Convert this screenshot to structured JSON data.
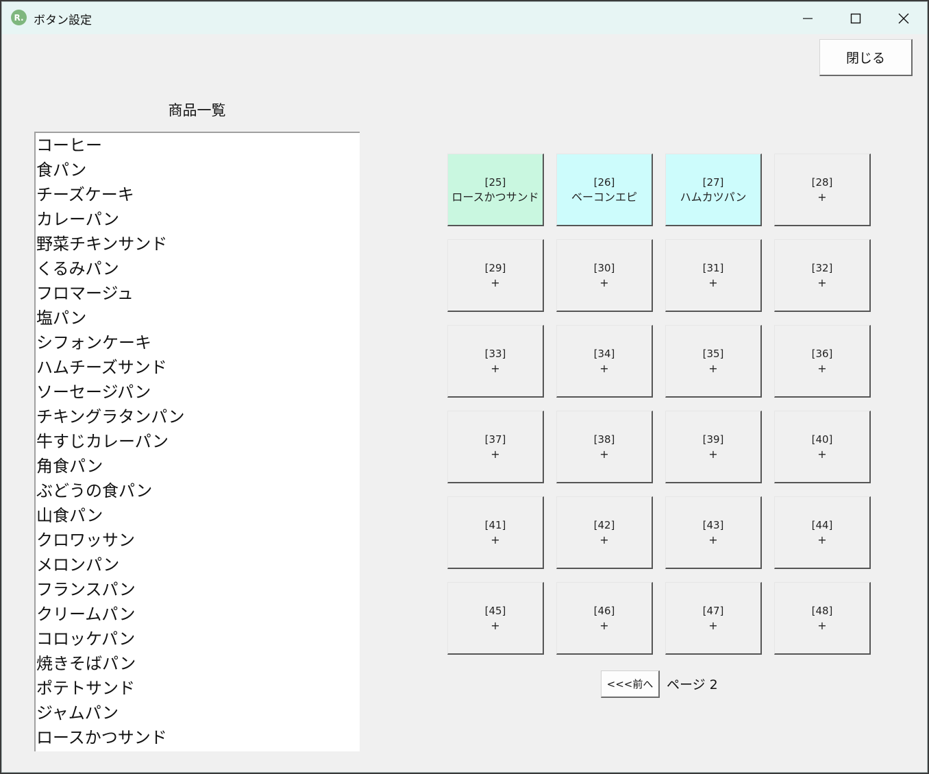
{
  "window": {
    "title": "ボタン設定",
    "app_icon_text": "R.",
    "controls": [
      "minimize",
      "maximize",
      "close"
    ]
  },
  "header": {
    "close_label": "閉じる"
  },
  "product_list": {
    "title": "商品一覧",
    "items": [
      "コーヒー",
      "食パン",
      "チーズケーキ",
      "カレーパン",
      "野菜チキンサンド",
      "くるみパン",
      "フロマージュ",
      "塩パン",
      "シフォンケーキ",
      "ハムチーズサンド",
      "ソーセージパン",
      "チキングラタンパン",
      "牛すじカレーパン",
      "角食パン",
      "ぶどうの食パン",
      "山食パン",
      "クロワッサン",
      "メロンパン",
      "フランスパン",
      "クリームパン",
      "コロッケパン",
      "焼きそばパン",
      "ポテトサンド",
      "ジャムパン",
      "ロースかつサンド"
    ]
  },
  "button_grid": {
    "slots": [
      {
        "id": "[25]",
        "label": "ロースかつサンド",
        "color": "#c9f7e0"
      },
      {
        "id": "[26]",
        "label": "ベーコンエピ",
        "color": "#cdfcfc"
      },
      {
        "id": "[27]",
        "label": "ハムカツパン",
        "color": "#cdfcfc"
      },
      {
        "id": "[28]",
        "label": "+"
      },
      {
        "id": "[29]",
        "label": "+"
      },
      {
        "id": "[30]",
        "label": "+"
      },
      {
        "id": "[31]",
        "label": "+"
      },
      {
        "id": "[32]",
        "label": "+"
      },
      {
        "id": "[33]",
        "label": "+"
      },
      {
        "id": "[34]",
        "label": "+"
      },
      {
        "id": "[35]",
        "label": "+"
      },
      {
        "id": "[36]",
        "label": "+"
      },
      {
        "id": "[37]",
        "label": "+"
      },
      {
        "id": "[38]",
        "label": "+"
      },
      {
        "id": "[39]",
        "label": "+"
      },
      {
        "id": "[40]",
        "label": "+"
      },
      {
        "id": "[41]",
        "label": "+"
      },
      {
        "id": "[42]",
        "label": "+"
      },
      {
        "id": "[43]",
        "label": "+"
      },
      {
        "id": "[44]",
        "label": "+"
      },
      {
        "id": "[45]",
        "label": "+"
      },
      {
        "id": "[46]",
        "label": "+"
      },
      {
        "id": "[47]",
        "label": "+"
      },
      {
        "id": "[48]",
        "label": "+"
      }
    ]
  },
  "pagination": {
    "prev_label": "<<<前へ",
    "page_label": "ページ 2"
  }
}
